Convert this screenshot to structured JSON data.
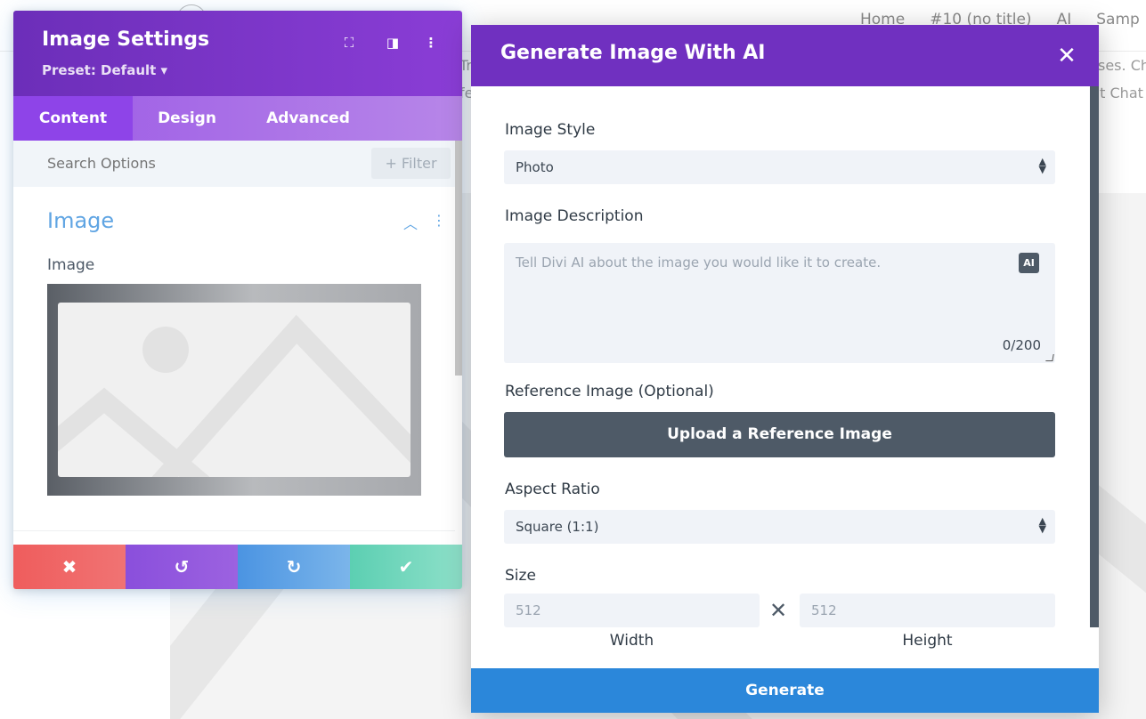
{
  "background": {
    "nav": [
      "Home",
      "#10 (no title)",
      "AI",
      "Samp"
    ],
    "snippets": [
      "Tr",
      "fe",
      "ses. Ch",
      "nt Chat"
    ]
  },
  "settings": {
    "title": "Image Settings",
    "preset": "Preset: Default ▾",
    "icons": {
      "expand": "⛶",
      "split": "◨",
      "menu": "⋮"
    },
    "tabs": [
      "Content",
      "Design",
      "Advanced"
    ],
    "search": {
      "placeholder": "Search Options",
      "filter_label": "+ Filter"
    },
    "section": {
      "title": "Image",
      "chevron": "︿",
      "dots": "⋮"
    },
    "field_label": "Image",
    "footer": {
      "cancel": "✖",
      "undo": "↺",
      "redo": "↻",
      "save": "✔"
    }
  },
  "modal": {
    "title": "Generate Image With AI",
    "close": "✕",
    "image_style": {
      "label": "Image Style",
      "value": "Photo"
    },
    "description": {
      "label": "Image Description",
      "placeholder": "Tell Divi AI about the image you would like it to create.",
      "badge": "AI",
      "counter": "0/200"
    },
    "reference": {
      "label": "Reference Image (Optional)",
      "button": "Upload a Reference Image"
    },
    "aspect": {
      "label": "Aspect Ratio",
      "value": "Square (1:1)"
    },
    "size": {
      "label": "Size",
      "width": "512",
      "height": "512",
      "width_caption": "Width",
      "height_caption": "Height",
      "times": "✕"
    },
    "generate": "Generate"
  }
}
